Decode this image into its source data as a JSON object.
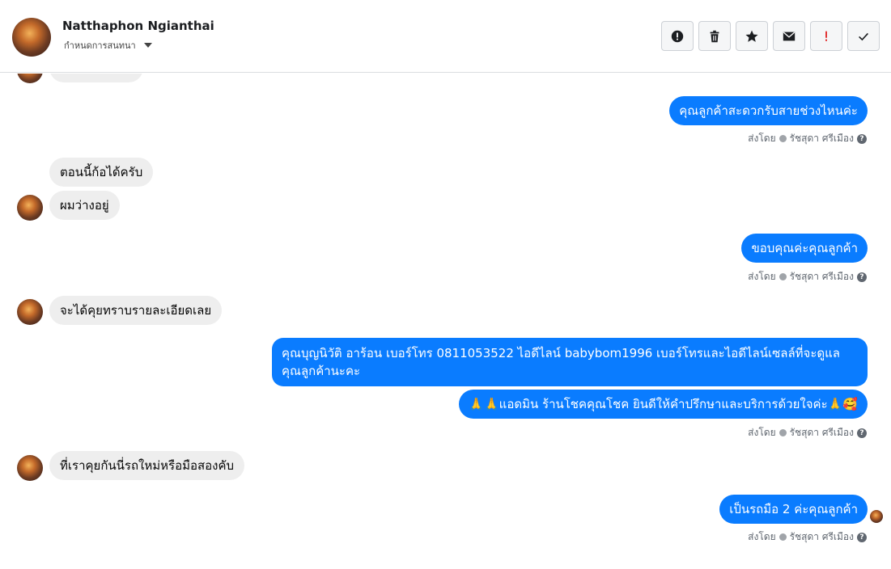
{
  "header": {
    "name": "Natthaphon Ngianthai",
    "subtitle": "กำหนดการสนทนา",
    "toolbar": {
      "alert_icon": "!",
      "delete_icon": "trash",
      "star_icon": "★",
      "mail_icon": "mail",
      "important_icon": "!",
      "done_icon": "✓"
    }
  },
  "messages": {
    "m1": "คุณลูกค้าสะดวกรับสายช่วงไหนค่ะ",
    "m2": "ตอนนี้ก้อได้ครับ",
    "m3": "ผมว่างอยู่",
    "m4": "ขอบคุณค่ะคุณลูกค้า",
    "m5": "จะได้คุยทราบรายละเอียดเลย",
    "m6": "คุณบุญนิวัติ  อาร้อน        เบอร์โทร 0811053522  ไอดีไลน์ babybom1996   เบอร์โทรและไอดีไลน์เซลล์ที่จะดูแลคุณลูกค้านะคะ",
    "m7": "🙏🙏แอดมิน ร้านโชคคุณโชค ยินดีให้คำปรึกษาและบริการด้วยใจค่ะ🙏🥰",
    "m8": "ที่เราคุยกันนี่รถใหม่หรือมือสองคับ",
    "m9": "เป็นรถมือ 2  ค่ะคุณลูกค้า"
  },
  "sent_by": {
    "prefix": "ส่งโดย",
    "agent": "รัชสุดา ศรีเมือง",
    "help": "?"
  }
}
